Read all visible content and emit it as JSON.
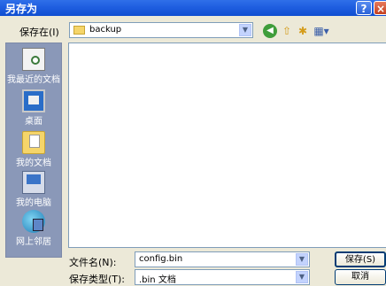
{
  "window": {
    "title": "另存为",
    "help_label": "?",
    "close_label": "×"
  },
  "savein": {
    "label": "保存在(I)",
    "value": "backup"
  },
  "toolbar": {
    "back_glyph": "◀",
    "up_glyph": "⇧",
    "newfolder_glyph": "✱",
    "view_glyph": "▦▾"
  },
  "places": [
    {
      "label": "我最近的文档",
      "icon": "recent-documents-icon"
    },
    {
      "label": "桌面",
      "icon": "desktop-icon"
    },
    {
      "label": "我的文档",
      "icon": "my-documents-icon"
    },
    {
      "label": "我的电脑",
      "icon": "my-computer-icon"
    },
    {
      "label": "网上邻居",
      "icon": "network-places-icon"
    }
  ],
  "filename": {
    "label": "文件名(N):",
    "value": "config.bin"
  },
  "filetype": {
    "label": "保存类型(T):",
    "value": ".bin 文档"
  },
  "buttons": {
    "save": "保存(S)",
    "cancel": "取消"
  }
}
